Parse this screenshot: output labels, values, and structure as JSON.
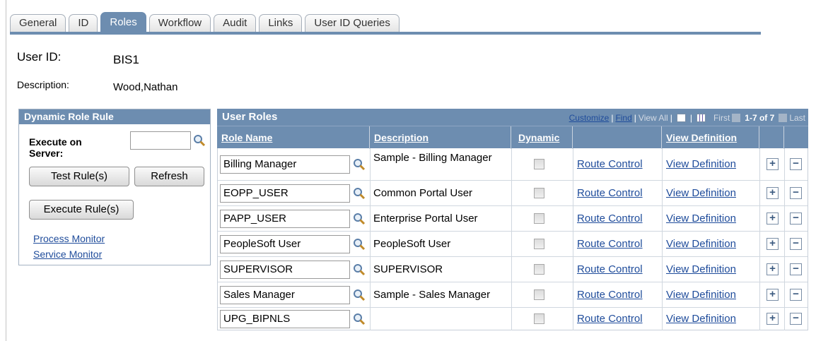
{
  "tabs": [
    "General",
    "ID",
    "Roles",
    "Workflow",
    "Audit",
    "Links",
    "User ID Queries"
  ],
  "active_tab": "Roles",
  "user": {
    "id_label": "User ID:",
    "id_value": "BIS1",
    "description_label": "Description:",
    "description_value": "Wood,Nathan"
  },
  "dynamic_panel": {
    "title": "Dynamic Role Rule",
    "execute_on_server_label": "Execute on Server:",
    "execute_on_server_value": "",
    "test_rule_button": "Test Rule(s)",
    "refresh_button": "Refresh",
    "execute_rule_button": "Execute Rule(s)",
    "process_monitor_link": "Process Monitor",
    "service_monitor_link": "Service Monitor"
  },
  "user_roles": {
    "title": "User Roles",
    "nav": {
      "customize": "Customize",
      "find": "Find",
      "view_all": "View All",
      "first": "First",
      "range": "1-7 of 7",
      "last": "Last"
    },
    "columns": [
      "Role Name",
      "Description",
      "Dynamic",
      "",
      "View Definition",
      "",
      ""
    ],
    "rows": [
      {
        "role": "Billing Manager",
        "description": "Sample - Billing Manager",
        "dynamic": false,
        "route": "Route Control",
        "view": "View Definition"
      },
      {
        "role": "EOPP_USER",
        "description": "Common Portal User",
        "dynamic": false,
        "route": "Route Control",
        "view": "View Definition"
      },
      {
        "role": "PAPP_USER",
        "description": "Enterprise Portal User",
        "dynamic": false,
        "route": "Route Control",
        "view": "View Definition"
      },
      {
        "role": "PeopleSoft User",
        "description": "PeopleSoft User",
        "dynamic": false,
        "route": "Route Control",
        "view": "View Definition"
      },
      {
        "role": "SUPERVISOR",
        "description": "SUPERVISOR",
        "dynamic": false,
        "route": "Route Control",
        "view": "View Definition"
      },
      {
        "role": "Sales Manager",
        "description": "Sample - Sales Manager",
        "dynamic": false,
        "route": "Route Control",
        "view": "View Definition"
      },
      {
        "role": "UPG_BIPNLS",
        "description": "",
        "dynamic": false,
        "route": "Route Control",
        "view": "View Definition"
      }
    ]
  },
  "icons": {
    "lookup": "magnifier-icon",
    "add_row": "plus-icon",
    "delete_row": "minus-icon"
  },
  "colors": {
    "header_blue": "#6d8db0",
    "link_blue": "#1f4c9b"
  }
}
